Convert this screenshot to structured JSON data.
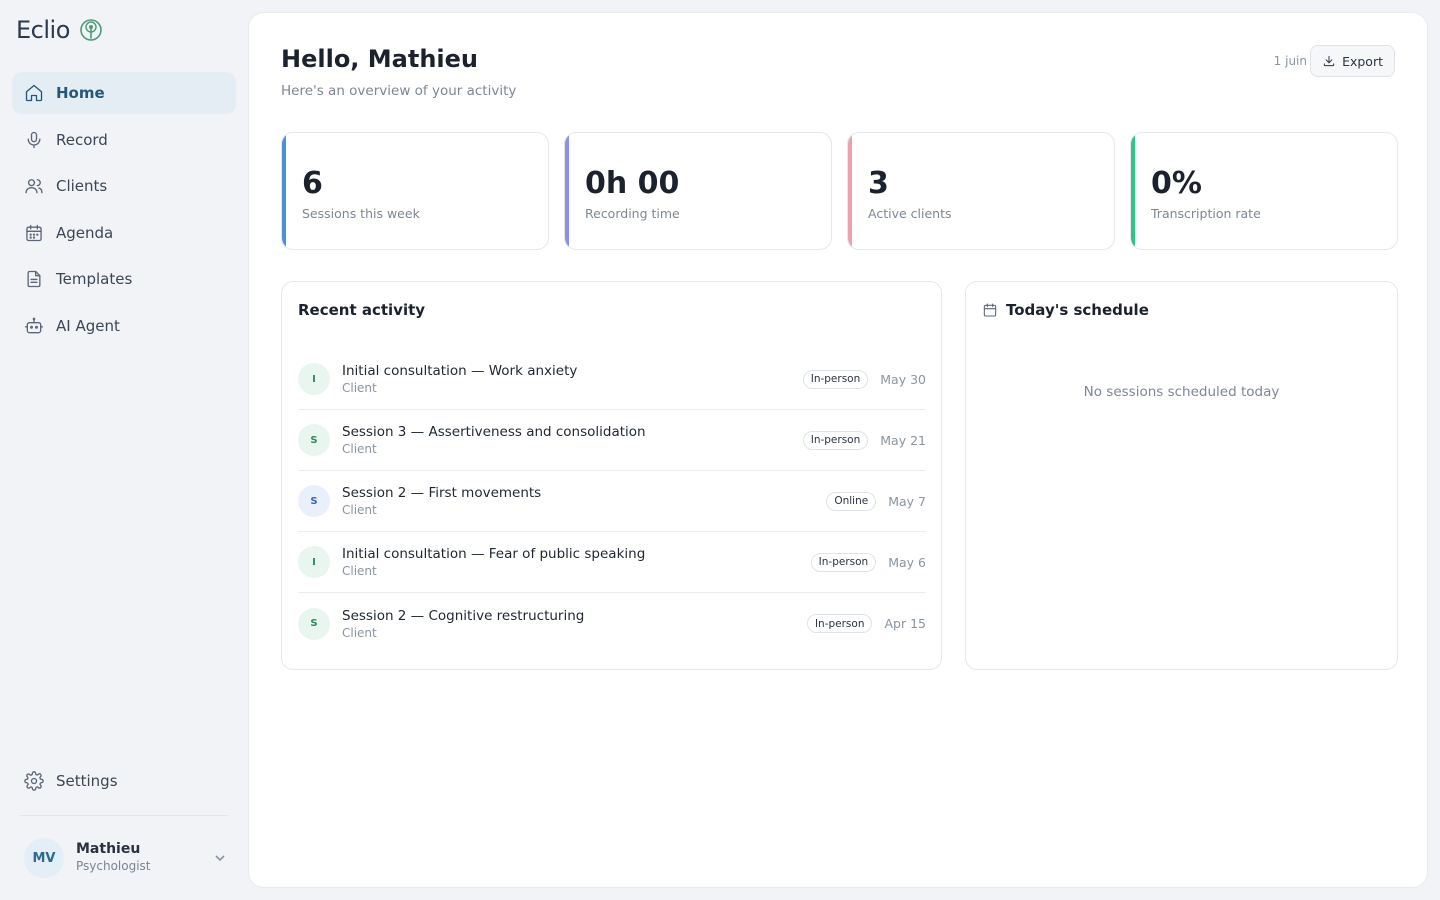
{
  "app": {
    "name": "Eclio"
  },
  "sidebar": {
    "items": [
      {
        "label": "Home",
        "icon": "home-icon",
        "active": true
      },
      {
        "label": "Record",
        "icon": "mic-icon"
      },
      {
        "label": "Clients",
        "icon": "users-icon"
      },
      {
        "label": "Agenda",
        "icon": "calendar-icon"
      },
      {
        "label": "Templates",
        "icon": "document-icon"
      },
      {
        "label": "AI Agent",
        "icon": "bot-icon"
      }
    ],
    "settings_label": "Settings",
    "user": {
      "initials": "MV",
      "name": "Mathieu",
      "role": "Psychologist"
    }
  },
  "header": {
    "greeting": "Hello, Mathieu",
    "subtitle": "Here's an overview of your activity",
    "date": "1 juin",
    "export_label": "Export"
  },
  "stats": [
    {
      "value": "6",
      "label": "Sessions this week",
      "color": "#4a90e2"
    },
    {
      "value": "0h 00",
      "label": "Recording time",
      "color": "#8b8fe8"
    },
    {
      "value": "3",
      "label": "Active clients",
      "color": "#f0a0a8"
    },
    {
      "value": "0%",
      "label": "Transcription rate",
      "color": "#2ec48a"
    }
  ],
  "activity": {
    "title": "Recent activity",
    "rows": [
      {
        "initial": "I",
        "title": "Initial consultation — Work anxiety",
        "sub": "Client",
        "mode": "In-person",
        "date": "May 30",
        "tone": "green"
      },
      {
        "initial": "S",
        "title": "Session 3 — Assertiveness and consolidation",
        "sub": "Client",
        "mode": "In-person",
        "date": "May 21",
        "tone": "green"
      },
      {
        "initial": "S",
        "title": "Session 2 — First movements",
        "sub": "Client",
        "mode": "Online",
        "date": "May 7",
        "tone": "blue"
      },
      {
        "initial": "I",
        "title": "Initial consultation — Fear of public speaking",
        "sub": "Client",
        "mode": "In-person",
        "date": "May 6",
        "tone": "green"
      },
      {
        "initial": "S",
        "title": "Session 2 — Cognitive restructuring",
        "sub": "Client",
        "mode": "In-person",
        "date": "Apr 15",
        "tone": "green"
      }
    ]
  },
  "schedule": {
    "title": "Today's schedule",
    "empty": "No sessions scheduled today"
  }
}
